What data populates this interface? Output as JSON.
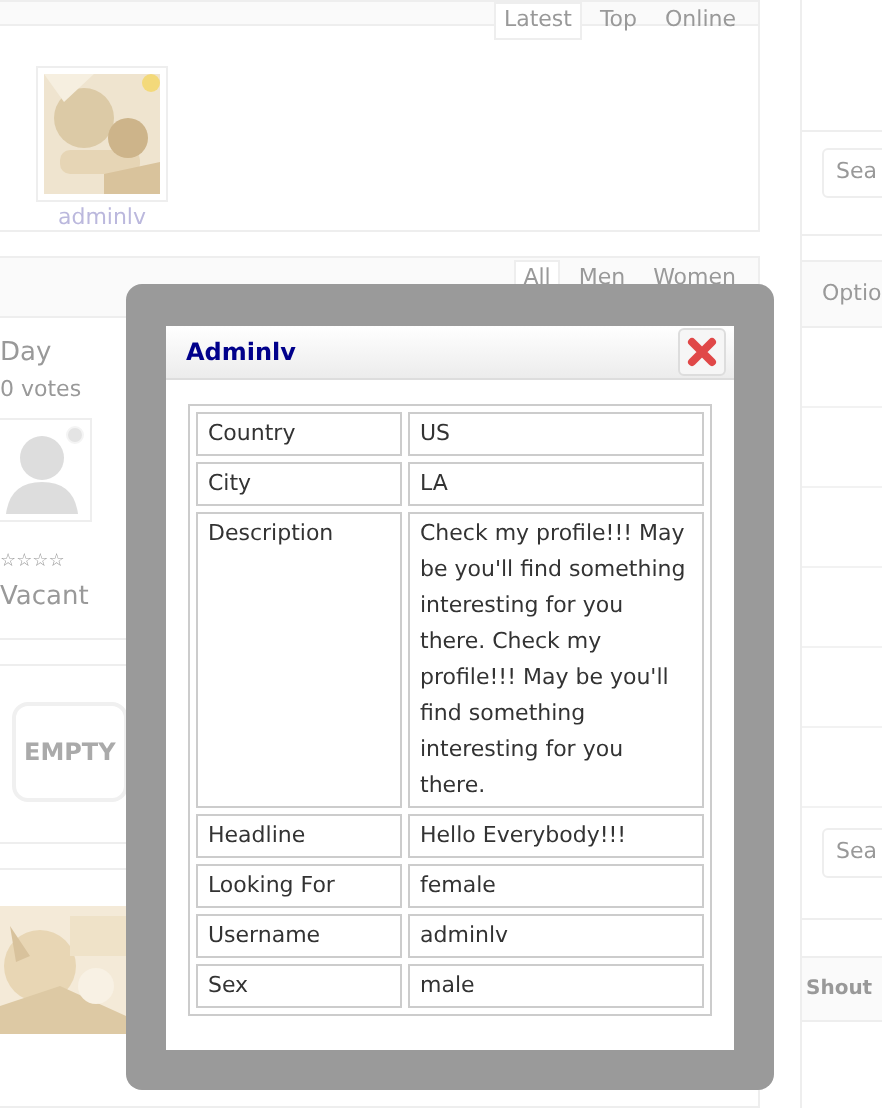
{
  "top_tabs": [
    {
      "label": "Latest",
      "selected": true
    },
    {
      "label": "Top",
      "selected": false
    },
    {
      "label": "Online",
      "selected": false
    }
  ],
  "members": [
    {
      "username": "adminlv",
      "online": true
    }
  ],
  "gender_tabs": [
    {
      "label": "All",
      "selected": true
    },
    {
      "label": "Men",
      "selected": false
    },
    {
      "label": "Women",
      "selected": false
    }
  ],
  "day_panel": {
    "title": "Day",
    "votes": "0 votes",
    "slots": [
      {
        "name": "Vacant",
        "stars": 0,
        "online": false
      }
    ]
  },
  "empty_button": "EMPTY",
  "sidebar": {
    "search_placeholder": "Sea",
    "options_title": "Optio",
    "search2_placeholder": "Sea",
    "shoutbox_title": "Shout"
  },
  "modal": {
    "title": "Adminlv",
    "rows": [
      {
        "label": "Country",
        "value": "US"
      },
      {
        "label": "City",
        "value": "LA"
      },
      {
        "label": "Description",
        "value": "Check my profile!!! May be you'll find something interesting for you there. Check my profile!!! May be you'll find something interesting for you there."
      },
      {
        "label": "Headline",
        "value": "Hello Everybody!!!"
      },
      {
        "label": "Looking For",
        "value": "female"
      },
      {
        "label": "Username",
        "value": "adminlv"
      },
      {
        "label": "Sex",
        "value": "male"
      }
    ]
  }
}
